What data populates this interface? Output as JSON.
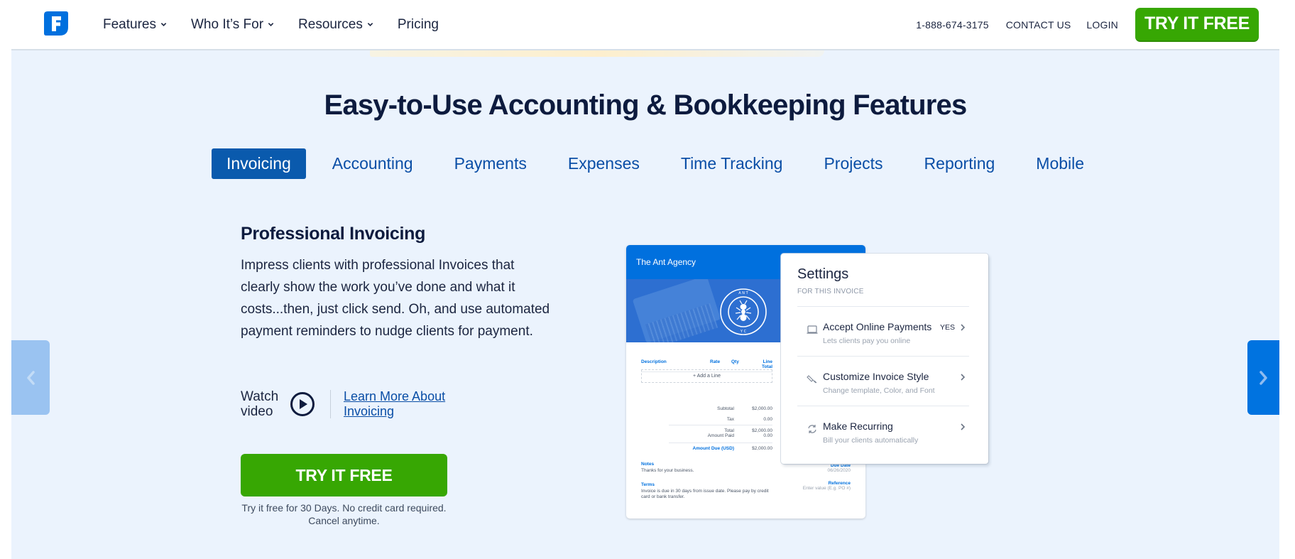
{
  "header": {
    "logo_icon": "freshbooks-f-logo-icon",
    "nav": [
      {
        "label": "Features",
        "has_dropdown": true
      },
      {
        "label": "Who It’s For",
        "has_dropdown": true
      },
      {
        "label": "Resources",
        "has_dropdown": true
      },
      {
        "label": "Pricing",
        "has_dropdown": false
      }
    ],
    "phone": "1-888-674-3175",
    "contact": "CONTACT US",
    "login": "LOGIN",
    "cta": "TRY IT FREE"
  },
  "colors": {
    "brand_blue": "#0070de",
    "tab_active": "#0a5aad",
    "cta_green": "#37a703",
    "panel_bg": "#ebf3fd",
    "heading": "#0d1b3e"
  },
  "section": {
    "title": "Easy-to-Use Accounting & Bookkeeping Features",
    "tabs": [
      {
        "label": "Invoicing",
        "active": true
      },
      {
        "label": "Accounting",
        "active": false
      },
      {
        "label": "Payments",
        "active": false
      },
      {
        "label": "Expenses",
        "active": false
      },
      {
        "label": "Time Tracking",
        "active": false
      },
      {
        "label": "Projects",
        "active": false
      },
      {
        "label": "Reporting",
        "active": false
      },
      {
        "label": "Mobile",
        "active": false
      }
    ],
    "feature": {
      "heading": "Professional Invoicing",
      "body": "Impress clients with professional Invoices that clearly show the work you’ve done and what it costs...then, just click send. Oh, and use automated payment reminders to nudge clients for payment.",
      "watch_label": "Watch video",
      "play_icon": "play-circle-icon",
      "learn_more": "Learn More About Invoicing",
      "cta": "TRY IT FREE",
      "fine_print": "Try it free for 30 Days. No credit card required. Cancel anytime."
    },
    "carousel": {
      "prev_icon": "chevron-left-icon",
      "next_icon": "chevron-right-icon"
    }
  },
  "invoice_mockup": {
    "company": "The Ant Agency",
    "emblem_text": "THE ANT AGENCY",
    "columns": [
      "Description",
      "Rate",
      "Qty",
      "Line Total"
    ],
    "add_line": "+ Add a Line",
    "totals": [
      {
        "label": "Subtotal",
        "value": "$2,000.00"
      },
      {
        "label": "Tax",
        "value": "0.00"
      },
      {
        "label": "Total",
        "value": "$2,000.00"
      },
      {
        "label": "Amount Paid",
        "value": "0.00"
      },
      {
        "label": "Amount Due (USD)",
        "value": "$2,000.00"
      }
    ],
    "notes_label": "Notes",
    "notes": "Thanks for your business.",
    "terms_label": "Terms",
    "terms": "Invoice is due in 30 days from issue date. Please pay by credit card or bank transfer.",
    "due_date_label": "Due Date",
    "due_date": "06/26/2020",
    "reference_label": "Reference",
    "reference_placeholder": "Enter value (E.g. PO #)"
  },
  "settings_card": {
    "title": "Settings",
    "subtitle": "FOR THIS INVOICE",
    "rows": [
      {
        "icon": "laptop-icon",
        "label": "Accept Online Payments",
        "desc": "Lets clients pay you online",
        "value": "YES"
      },
      {
        "icon": "paintbrush-icon",
        "label": "Customize Invoice Style",
        "desc": "Change template, Color, and Font",
        "value": ""
      },
      {
        "icon": "recurring-arrows-icon",
        "label": "Make Recurring",
        "desc": "Bill your clients automatically",
        "value": ""
      }
    ]
  }
}
